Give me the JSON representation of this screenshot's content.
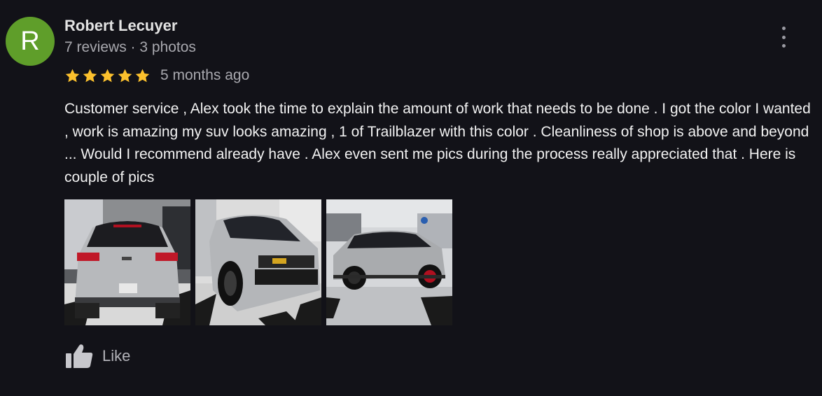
{
  "review": {
    "avatar_letter": "R",
    "avatar_color": "#5f9e2a",
    "author_name": "Robert Lecuyer",
    "author_meta": "7 reviews · 3 photos",
    "rating": 5,
    "rating_max": 5,
    "star_color": "#fbc02d",
    "date": "5 months ago",
    "text": "Customer service , Alex took the time to explain the amount of work that needs to be done . I got the color I wanted , work is amazing my suv looks amazing , 1 of Trailblazer with this color . Cleanliness of shop is above and beyond ... Would I recommend already have . Alex even sent me pics during the process really appreciated that . Here is couple of pics",
    "photos": [
      {
        "name": "photo-rear-view"
      },
      {
        "name": "photo-front-view"
      },
      {
        "name": "photo-side-view"
      }
    ],
    "like_label": "Like",
    "icons": {
      "more": "more-vertical-icon",
      "like": "thumbs-up-icon",
      "star": "star-icon"
    }
  }
}
